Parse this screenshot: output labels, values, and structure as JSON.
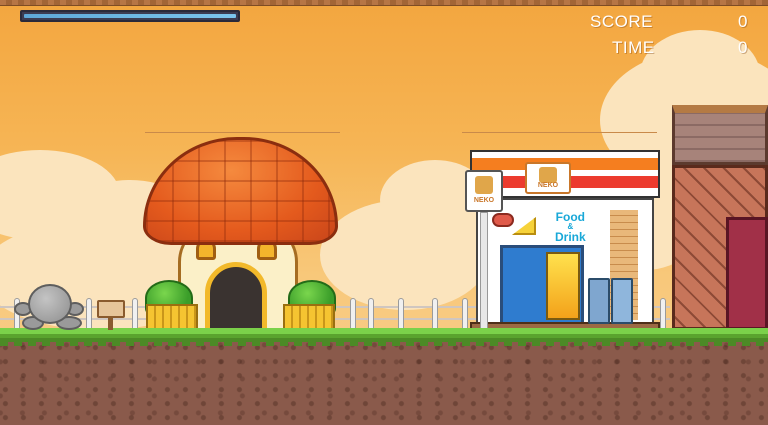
{
  "hud": {
    "score_label": "SCORE",
    "score_value": "0",
    "time_label": "TIME",
    "time_value": "0",
    "health_fraction": 1.0
  },
  "colors": {
    "sky_top": "#f3a63f",
    "sky_bottom": "#f6cf92",
    "grass": "#7bd14a",
    "dirt": "#8a5a4b",
    "hud_text": "#ffffff"
  },
  "scene": {
    "store_sign": "NEKO",
    "store_banner_line1": "Food",
    "store_banner_line2": "&",
    "store_banner_line3": "Drink"
  }
}
